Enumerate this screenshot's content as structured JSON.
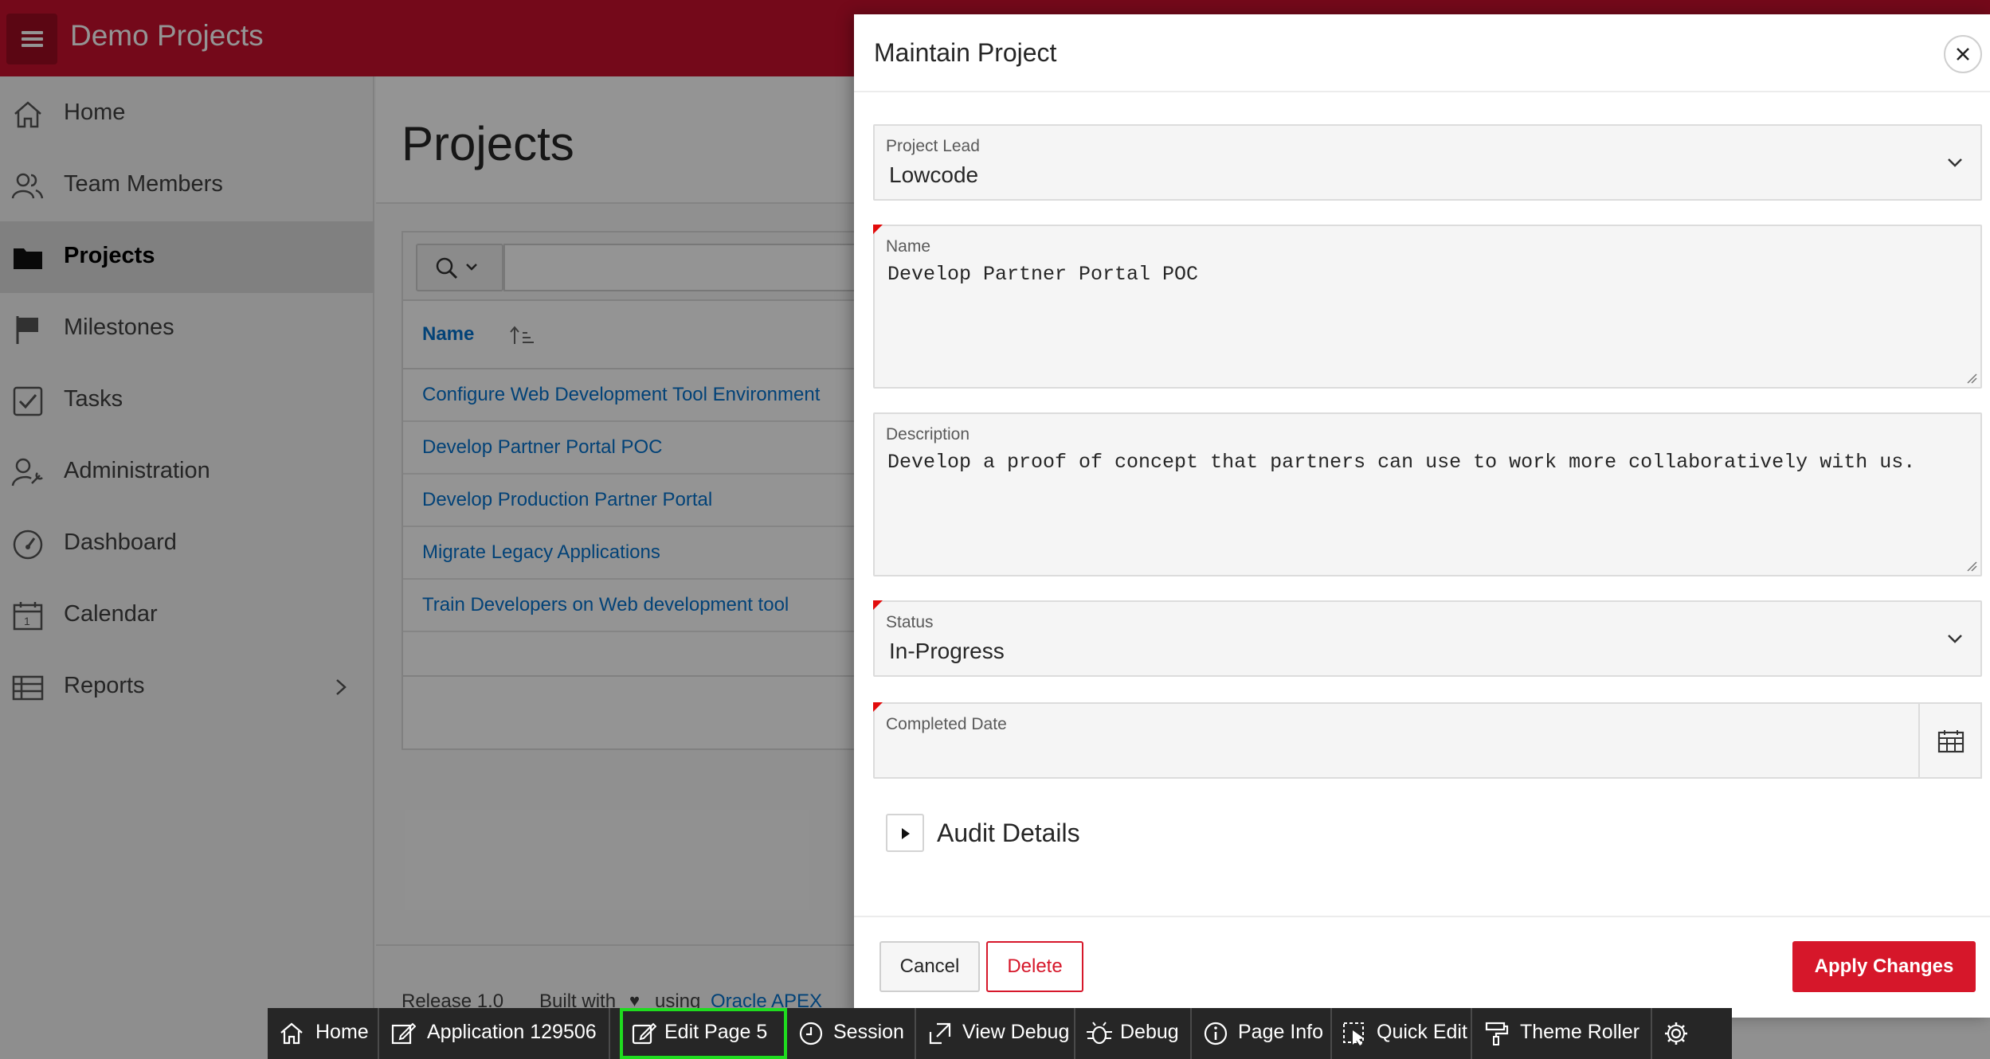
{
  "app": {
    "title": "Demo Projects"
  },
  "sidebar": {
    "items": [
      {
        "label": "Home",
        "icon": "home-icon"
      },
      {
        "label": "Team Members",
        "icon": "users-icon"
      },
      {
        "label": "Projects",
        "icon": "folder-icon",
        "active": true
      },
      {
        "label": "Milestones",
        "icon": "flag-icon"
      },
      {
        "label": "Tasks",
        "icon": "checkbox-icon"
      },
      {
        "label": "Administration",
        "icon": "user-wrench-icon"
      },
      {
        "label": "Dashboard",
        "icon": "gauge-icon"
      },
      {
        "label": "Calendar",
        "icon": "calendar-icon"
      },
      {
        "label": "Reports",
        "icon": "table-icon"
      }
    ]
  },
  "page": {
    "title": "Projects",
    "report": {
      "column_header": "Name",
      "rows": [
        "Configure Web Development Tool Environment",
        "Develop Partner Portal POC",
        "Develop Production Partner Portal",
        "Migrate Legacy Applications",
        "Train Developers on Web development tool"
      ]
    },
    "footer": {
      "release": "Release 1.0",
      "built_with": "Built with",
      "using": "using",
      "link": "Oracle APEX"
    }
  },
  "dialog": {
    "title": "Maintain Project",
    "fields": {
      "project_lead": {
        "label": "Project Lead",
        "value": "Lowcode"
      },
      "name": {
        "label": "Name",
        "value": "Develop Partner Portal POC"
      },
      "description": {
        "label": "Description",
        "value": "Develop a proof of concept that partners can use to work more collaboratively with us."
      },
      "status": {
        "label": "Status",
        "value": "In-Progress"
      },
      "completed_date": {
        "label": "Completed Date",
        "value": ""
      }
    },
    "audit_label": "Audit Details",
    "buttons": {
      "cancel": "Cancel",
      "delete": "Delete",
      "apply": "Apply Changes"
    }
  },
  "devbar": {
    "home": "Home",
    "application": "Application 129506",
    "edit_page": "Edit Page 5",
    "session": "Session",
    "view_debug": "View Debug",
    "debug": "Debug",
    "page_info": "Page Info",
    "quick_edit": "Quick Edit",
    "theme_roller": "Theme Roller"
  },
  "colors": {
    "brand": "#c8102e",
    "link": "#0572ce",
    "danger": "#d6172a",
    "highlight": "#1fdc1f"
  }
}
